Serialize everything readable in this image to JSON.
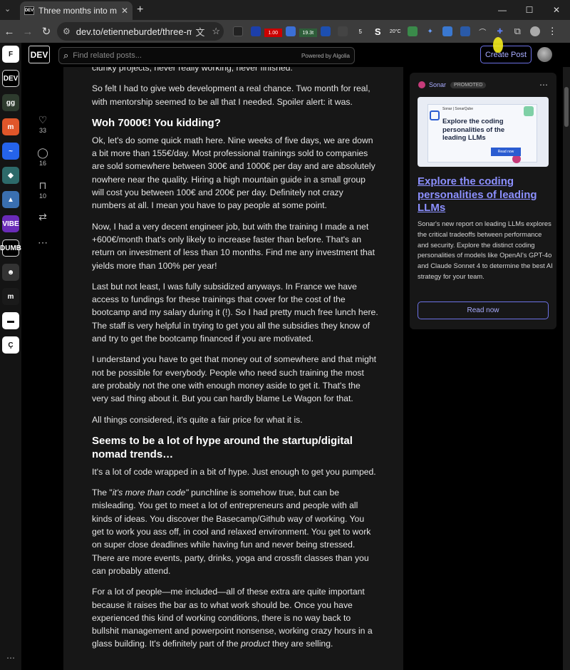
{
  "browser": {
    "tab_title": "Three months into my new",
    "tab_favicon": "DEV",
    "url": "dev.to/etienneburdet/three-mo...",
    "ext_badges": [
      "1.00",
      "19.3t",
      "5",
      "20°C"
    ]
  },
  "header": {
    "logo": "DEV",
    "search_placeholder": "Find related posts...",
    "powered_by": "Powered by Algolia",
    "create_post": "Create Post"
  },
  "actions": {
    "reactions": "33",
    "comments": "16",
    "bookmarks": "10"
  },
  "article": {
    "p0": "clunky projects, never really working, never finished.",
    "p1": "So felt I had to give web development a real chance. Two month for real, with mentorship seemed to be all that I needed. Spoiler alert: it was.",
    "h1": "Woh 7000€! You kidding?",
    "p2": "Ok, let's do some quick math here. Nine weeks of five days, we are down a bit more than 155€/day. Most professional trainings sold to companies are sold somewhere between 300€ and 1000€ per day and are absolutely nowhere near the quality. Hiring a high mountain guide in a small group will cost you between 100€ and 200€ per day. Definitely not crazy numbers at all. I mean you have to pay people at some point.",
    "p3": "Now, I had a very decent engineer job, but with the training I made a net +600€/month that's only likely to increase faster than before. That's an return on investment of less than 10 months. Find me any investment that yields more than 100% per year!",
    "p4": "Last but not least, I was fully subsidized anyways. In France we have access to fundings for these trainings that cover for the cost of the bootcamp and my salary during it (!). So I had pretty much free lunch here. The staff is very helpful in trying to get you all the subsidies they know of and try to get the bootcamp financed if you are motivated.",
    "p5": "I understand you have to get that money out of somewhere and that might not be possible for everybody. People who need such training the most are probably not the one with enough money aside to get it. That's the very sad thing about it. But you can hardly blame Le Wagon for that.",
    "p6": "All things considered, it's quite a fair price for what it is.",
    "h2": "Seems to be a lot of hype around the startup/digital nomad trends…",
    "p7": "It's a lot of code wrapped in a bit of hype. Just enough to get you pumped.",
    "p8_a": "The \"",
    "p8_em": "it's more than code\"",
    "p8_b": " punchline is somehow true, but can be misleading. You get to meet a lot of entrepreneurs and people with all kinds of ideas. You discover the Basecamp/Github way of working. You get to work you ass off, in cool and relaxed environment. You get to work on super close deadlines while having fun and never being stressed. There are more events, party, drinks, yoga and crossfit classes than you can probably attend.",
    "p9_a": "For a lot of people—me included—all of these extra are quite important because it raises the bar as to what work should be. Once you have experienced this kind of working conditions, there is no way back to bullshit management and powerpoint nonsense, working crazy hours in a glass building. It's definitely part of the ",
    "p9_em": "product",
    "p9_b": " they are selling."
  },
  "ad": {
    "brand": "Sonar",
    "promoted": "PROMOTED",
    "banner_brand": "Sonar | SonarQube",
    "banner_title": "Explore the coding personalities of the leading LLMs",
    "banner_button": "Read now",
    "title": "Explore the coding personalities of leading LLMs",
    "description": "Sonar's new report on leading LLMs explores the critical tradeoffs between performance and security. Explore the distinct coding personalities of models like OpenAI's GPT-4o and Claude Sonnet 4 to determine the best AI strategy for your team.",
    "button": "Read now"
  },
  "rail_apps": [
    {
      "label": "F",
      "color": "#ffffff"
    },
    {
      "label": "DEV",
      "color": "#000000"
    },
    {
      "label": "gg",
      "color": "#2e3b2e"
    },
    {
      "label": "m",
      "color": "#e0562a"
    },
    {
      "label": "~",
      "color": "#2563eb"
    },
    {
      "label": "◆",
      "color": "#2d6a6a"
    },
    {
      "label": "▲",
      "color": "#3a6fb0"
    },
    {
      "label": "VIBE",
      "color": "#6a2bb8"
    },
    {
      "label": "DUMB",
      "color": "#000000"
    },
    {
      "label": "☻",
      "color": "#333333"
    },
    {
      "label": "m",
      "color": "#1a1a1a"
    },
    {
      "label": "▬",
      "color": "#ffffff"
    },
    {
      "label": "Ç",
      "color": "#ffffff"
    }
  ]
}
